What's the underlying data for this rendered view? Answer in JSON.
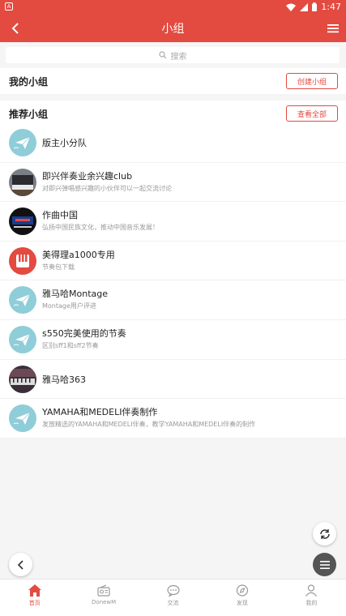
{
  "statusbar": {
    "left_badge": "A",
    "time": "1:47"
  },
  "appbar": {
    "title": "小组"
  },
  "search": {
    "placeholder": "搜索"
  },
  "my_groups": {
    "title": "我的小组",
    "create_button": "创建小组"
  },
  "recommended": {
    "title": "推荐小组",
    "view_all_button": "查看全部"
  },
  "groups": [
    {
      "name": "版主小分队",
      "desc": "",
      "avatar": "paper-plane"
    },
    {
      "name": "即兴伴奏业余兴趣club",
      "desc": "对即兴弹唱感兴趣的小伙伴可以一起交流讨论",
      "avatar": "photo-piano"
    },
    {
      "name": "作曲中国",
      "desc": "弘扬中国民族文化，推动中国音乐发展！",
      "avatar": "photo-logo"
    },
    {
      "name": "美得理a1000专用",
      "desc": "节奏包下载",
      "avatar": "piano-keys"
    },
    {
      "name": "雅马哈Montage",
      "desc": "Montage用户评进",
      "avatar": "paper-plane"
    },
    {
      "name": "s550完美使用的节奏",
      "desc": "区别sff1和sff2节奏",
      "avatar": "paper-plane"
    },
    {
      "name": "雅马哈363",
      "desc": "",
      "avatar": "photo-keyboard"
    },
    {
      "name": "YAMAHA和MEDELI伴奏制作",
      "desc": "发放精选的YAMAHA和MEDELI伴奏，教学YAMAHA和MEDELI伴奏的制作",
      "avatar": "paper-plane"
    }
  ],
  "tabs": [
    {
      "label": "首页",
      "icon": "home-icon",
      "active": true
    },
    {
      "label": "DonewM",
      "icon": "radio-icon",
      "active": false
    },
    {
      "label": "交流",
      "icon": "chat-icon",
      "active": false
    },
    {
      "label": "发现",
      "icon": "compass-icon",
      "active": false
    },
    {
      "label": "我的",
      "icon": "user-icon",
      "active": false
    }
  ],
  "colors": {
    "accent": "#e34a40",
    "avatar_teal": "#8fcdd8"
  }
}
